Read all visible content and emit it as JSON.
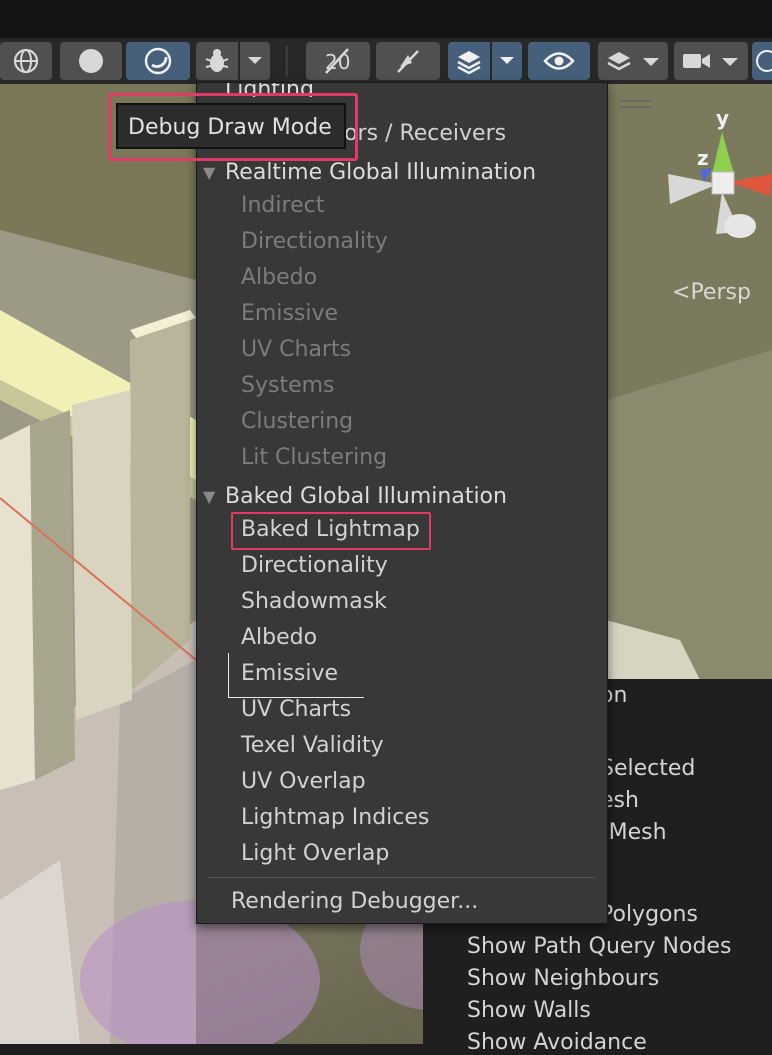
{
  "toolbar": {
    "tooltip": "Debug Draw Mode",
    "buttons": [
      {
        "icon": "globe-icon"
      },
      {
        "icon": "circle-icon"
      },
      {
        "icon": "crescent-icon",
        "active": true
      },
      {
        "icon": "bug-icon"
      },
      {
        "icon": "chevron-down-icon"
      },
      {
        "icon": "lighting-off-icon"
      },
      {
        "icon": "audio-off-icon"
      },
      {
        "icon": "gizmo-layers-icon",
        "active": true
      },
      {
        "icon": "eye-icon",
        "active": true
      },
      {
        "icon": "layers-icon"
      },
      {
        "icon": "camera-icon"
      }
    ]
  },
  "menu": {
    "partial_top": "Lighting",
    "partial_second": "Contributors / Receivers",
    "realtime_header": "Realtime Global Illumination",
    "realtime_items": [
      "Indirect",
      "Directionality",
      "Albedo",
      "Emissive",
      "UV Charts",
      "Systems",
      "Clustering",
      "Lit Clustering"
    ],
    "baked_header": "Baked Global Illumination",
    "baked_items": [
      "Baked Lightmap",
      "Directionality",
      "Shadowmask",
      "Albedo",
      "Emissive",
      "UV Charts",
      "Texel Validity",
      "UV Overlap",
      "Lightmap Indices",
      "Light Overlap"
    ],
    "footer": "Rendering Debugger..."
  },
  "scene": {
    "persp_label": "Persp",
    "gizmo_y": "y",
    "gizmo_z": "z"
  },
  "overlay": {
    "lines": [
      "on",
      "Selected",
      "esh",
      "tMesh",
      "Polygons",
      "Show Path Query Nodes",
      "Show Neighbours",
      "Show Walls",
      "Show Avoidance"
    ]
  },
  "colors": {
    "highlight": "#e03b67",
    "active_button": "#46607c",
    "menu_bg": "#383838"
  }
}
